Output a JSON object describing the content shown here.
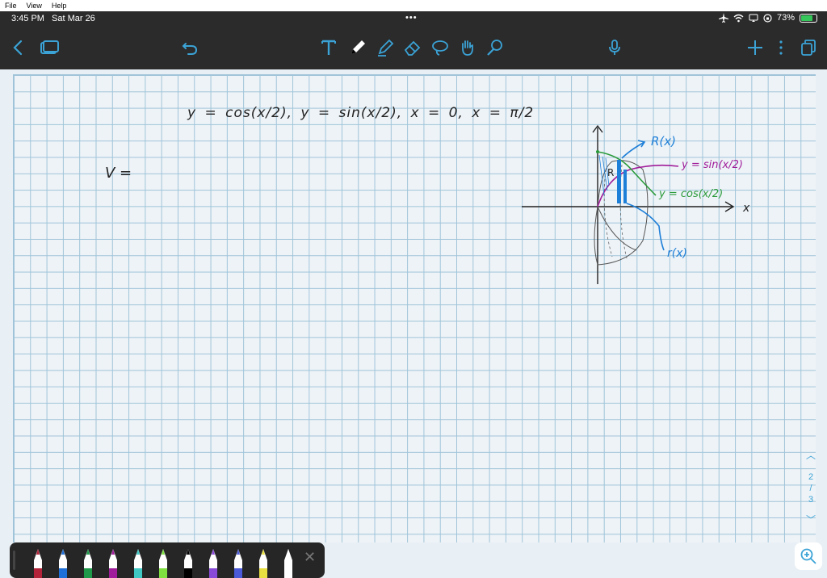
{
  "menu": {
    "items": [
      "File",
      "View",
      "Help"
    ]
  },
  "status": {
    "time": "3:45 PM",
    "date": "Sat Mar 26",
    "dots": "•••",
    "battery": "73%"
  },
  "toolbar": {
    "icons": [
      "back-chevron-icon",
      "pages-icon",
      "undo-icon",
      "text-tool-icon",
      "pen-tool-icon",
      "highlighter-tool-icon",
      "eraser-tool-icon",
      "lasso-tool-icon",
      "hand-tool-icon",
      "shapes-tool-icon",
      "microphone-icon",
      "add-icon",
      "more-icon",
      "copy-icon"
    ]
  },
  "note": {
    "equation": "y = cos(x/2),  y = sin(x/2),  x = 0,  x = π/2",
    "volume_label": "V ="
  },
  "sketch": {
    "label_R": "R(x)",
    "label_sin": "y = sin(x/2)",
    "label_cos": "y = cos(x/2)",
    "label_r": "r(x)",
    "label_x": "x",
    "label_region": "R"
  },
  "pages": {
    "current": "2",
    "separator": "/",
    "total": "3"
  },
  "colors": {
    "toolbar_bg": "#2b2b2b",
    "accent": "#3ba3d6",
    "grid_line": "#9fc4d9",
    "ink_blue": "#1e7fd8",
    "ink_green": "#2a9a3a",
    "ink_purple": "#a01c9a"
  },
  "pens": [
    {
      "name": "pen-maroon",
      "color": "#b3243a"
    },
    {
      "name": "pen-blue",
      "color": "#1e6fd8"
    },
    {
      "name": "pen-green",
      "color": "#1f9a4a"
    },
    {
      "name": "pen-purple",
      "color": "#a01c9a"
    },
    {
      "name": "pen-teal",
      "color": "#3fc8c4"
    },
    {
      "name": "pen-lime",
      "color": "#7fe040"
    },
    {
      "name": "pen-black",
      "color": "#000000"
    },
    {
      "name": "highlighter-purple",
      "color": "#8a4ad8"
    },
    {
      "name": "highlighter-blue",
      "color": "#4a5ad8"
    },
    {
      "name": "highlighter-yellow",
      "color": "#e8e040"
    },
    {
      "name": "pen-white",
      "color": "#ffffff"
    }
  ]
}
